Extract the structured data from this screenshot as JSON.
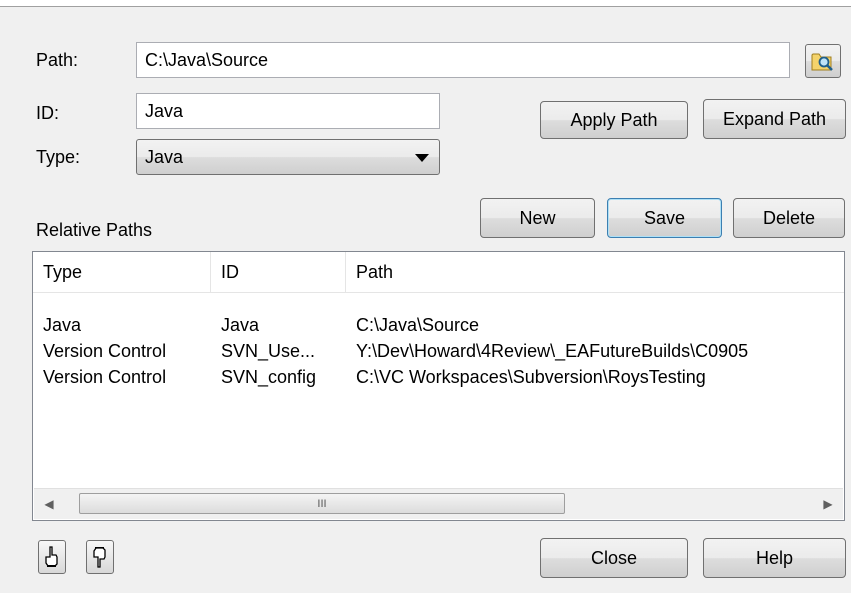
{
  "form": {
    "path_label": "Path:",
    "path_value": "C:\\Java\\Source",
    "id_label": "ID:",
    "id_value": "Java",
    "type_label": "Type:",
    "type_value": "Java"
  },
  "buttons": {
    "apply_path": "Apply Path",
    "expand_path": "Expand Path",
    "new": "New",
    "save": "Save",
    "delete": "Delete",
    "close": "Close",
    "help": "Help"
  },
  "relative_paths": {
    "label": "Relative Paths",
    "columns": [
      "Type",
      "ID",
      "Path"
    ],
    "rows": [
      [
        "Java",
        "Java",
        "C:\\Java\\Source"
      ],
      [
        "Version Control",
        "SVN_Use...",
        "Y:\\Dev\\Howard\\4Review\\_EAFutureBuilds\\C0905"
      ],
      [
        "Version Control",
        "SVN_config",
        "C:\\VC Workspaces\\Subversion\\RoysTesting"
      ]
    ],
    "scroll_thumb_grip": "III"
  },
  "icons": {
    "browse": "folder-search-icon",
    "move_up": "hand-point-up-icon",
    "move_down": "hand-point-down-icon",
    "scroll_left": "arrow-left-icon",
    "scroll_right": "arrow-right-icon"
  }
}
